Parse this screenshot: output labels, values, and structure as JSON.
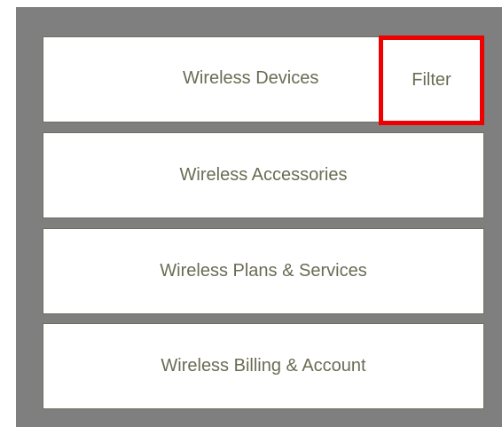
{
  "menu": {
    "items": [
      {
        "label": "Wireless Devices"
      },
      {
        "label": "Wireless Accessories"
      },
      {
        "label": "Wireless Plans & Services"
      },
      {
        "label": "Wireless Billing & Account"
      }
    ],
    "filter_label": "Filter"
  },
  "colors": {
    "panel_background": "#7f7f7f",
    "item_background": "#ffffff",
    "text": "#6b6b55",
    "highlight_border": "#ee0000"
  }
}
